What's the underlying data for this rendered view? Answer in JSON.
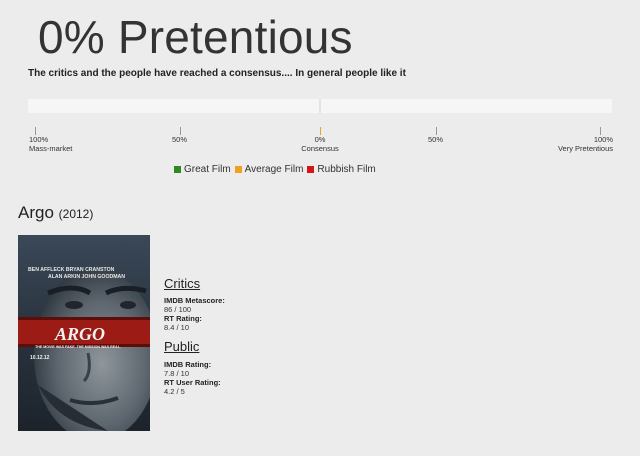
{
  "headline": "0% Pretentious",
  "subline": "The critics and the people have reached a consensus.... In general people like it",
  "scale": {
    "ticks": [
      {
        "top": "100%",
        "bottom": "Mass-market"
      },
      {
        "top": "50%",
        "bottom": ""
      },
      {
        "top": "0%",
        "bottom": "Consensus"
      },
      {
        "top": "50%",
        "bottom": ""
      },
      {
        "top": "100%",
        "bottom": "Very Pretentious"
      }
    ],
    "marker_color": "#f0a030"
  },
  "legend": [
    {
      "label": "Great Film",
      "color": "#2e8b1e"
    },
    {
      "label": "Average Film",
      "color": "#f0a020"
    },
    {
      "label": "Rubbish Film",
      "color": "#d01818"
    }
  ],
  "film": {
    "title": "Argo",
    "year": "(2012)",
    "poster": {
      "cast_line1": "BEN AFFLECK  BRYAN CRANSTON",
      "cast_line2": "ALAN ARKIN  JOHN GOODMAN",
      "logo": "ARGO",
      "tagline": "THE MOVIE WAS FAKE. THE MISSION WAS REAL.",
      "date": "10.12.12"
    },
    "critics": {
      "heading": "Critics",
      "imdb_label": "IMDB Metascore:",
      "imdb_value": "86 / 100",
      "rt_label": "RT Rating:",
      "rt_value": "8.4 / 10"
    },
    "public": {
      "heading": "Public",
      "imdb_label": "IMDB Rating:",
      "imdb_value": "7.8 / 10",
      "rt_label": "RT User Rating:",
      "rt_value": "4.2 / 5"
    }
  }
}
